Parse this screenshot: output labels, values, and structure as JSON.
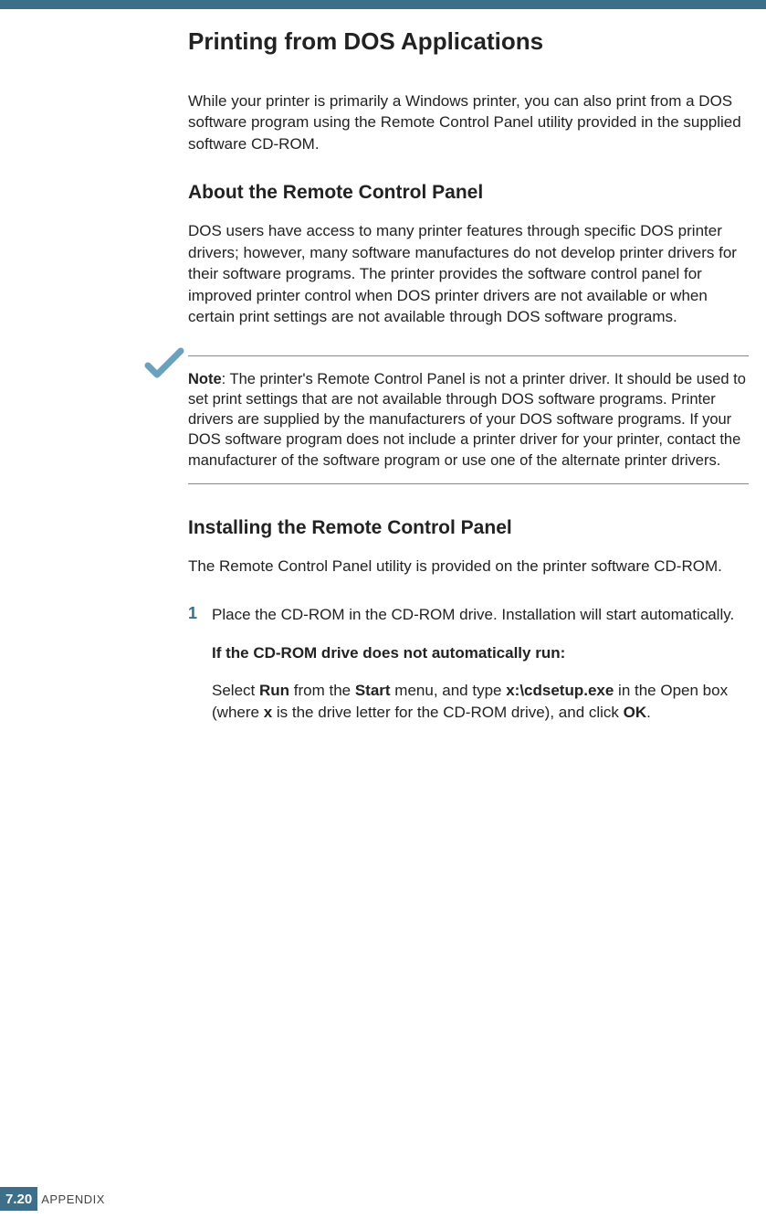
{
  "heading_main": "Printing from DOS Applications",
  "intro": "While your printer is primarily a Windows printer, you can also print from a DOS software program using the Remote Control Panel utility provided in the supplied software CD-ROM.",
  "heading_about": "About the Remote Control Panel",
  "about_body": "DOS users have access to many printer features through specific DOS printer drivers; however, many software manufactures do not develop printer drivers for their software programs. The printer provides the software control panel for improved printer control when DOS printer drivers are not available or when certain print settings are not available through DOS software programs.",
  "note_label": "Note",
  "note_body": ": The printer's Remote Control Panel is not a printer driver. It should be used to set print settings that are not available through DOS software programs. Printer drivers are supplied by the manufacturers of your DOS software programs. If your DOS software program does not include a printer driver for your printer, contact the manufacturer of the software program or use one of the alternate printer drivers.",
  "heading_install": "Installing the Remote Control Panel",
  "install_body": "The Remote Control Panel utility is provided on the printer software CD-ROM.",
  "step1_num": "1",
  "step1_text": "Place the CD-ROM in the CD-ROM drive. Installation will start automatically.",
  "step1_sub_bold": "If the CD-ROM drive does not automatically run:",
  "run_pre": "Select ",
  "run_b1": "Run",
  "run_mid1": " from the ",
  "run_b2": "Start",
  "run_mid2": " menu, and type ",
  "run_b3": "x:\\cdsetup.exe",
  "run_mid3": " in the Open box (where ",
  "run_b4": "x",
  "run_mid4": " is the drive letter for the CD-ROM drive), and click ",
  "run_b5": "OK",
  "run_end": ".",
  "page_chapter": "7.",
  "page_number": "20",
  "footer_section": "APPENDIX"
}
